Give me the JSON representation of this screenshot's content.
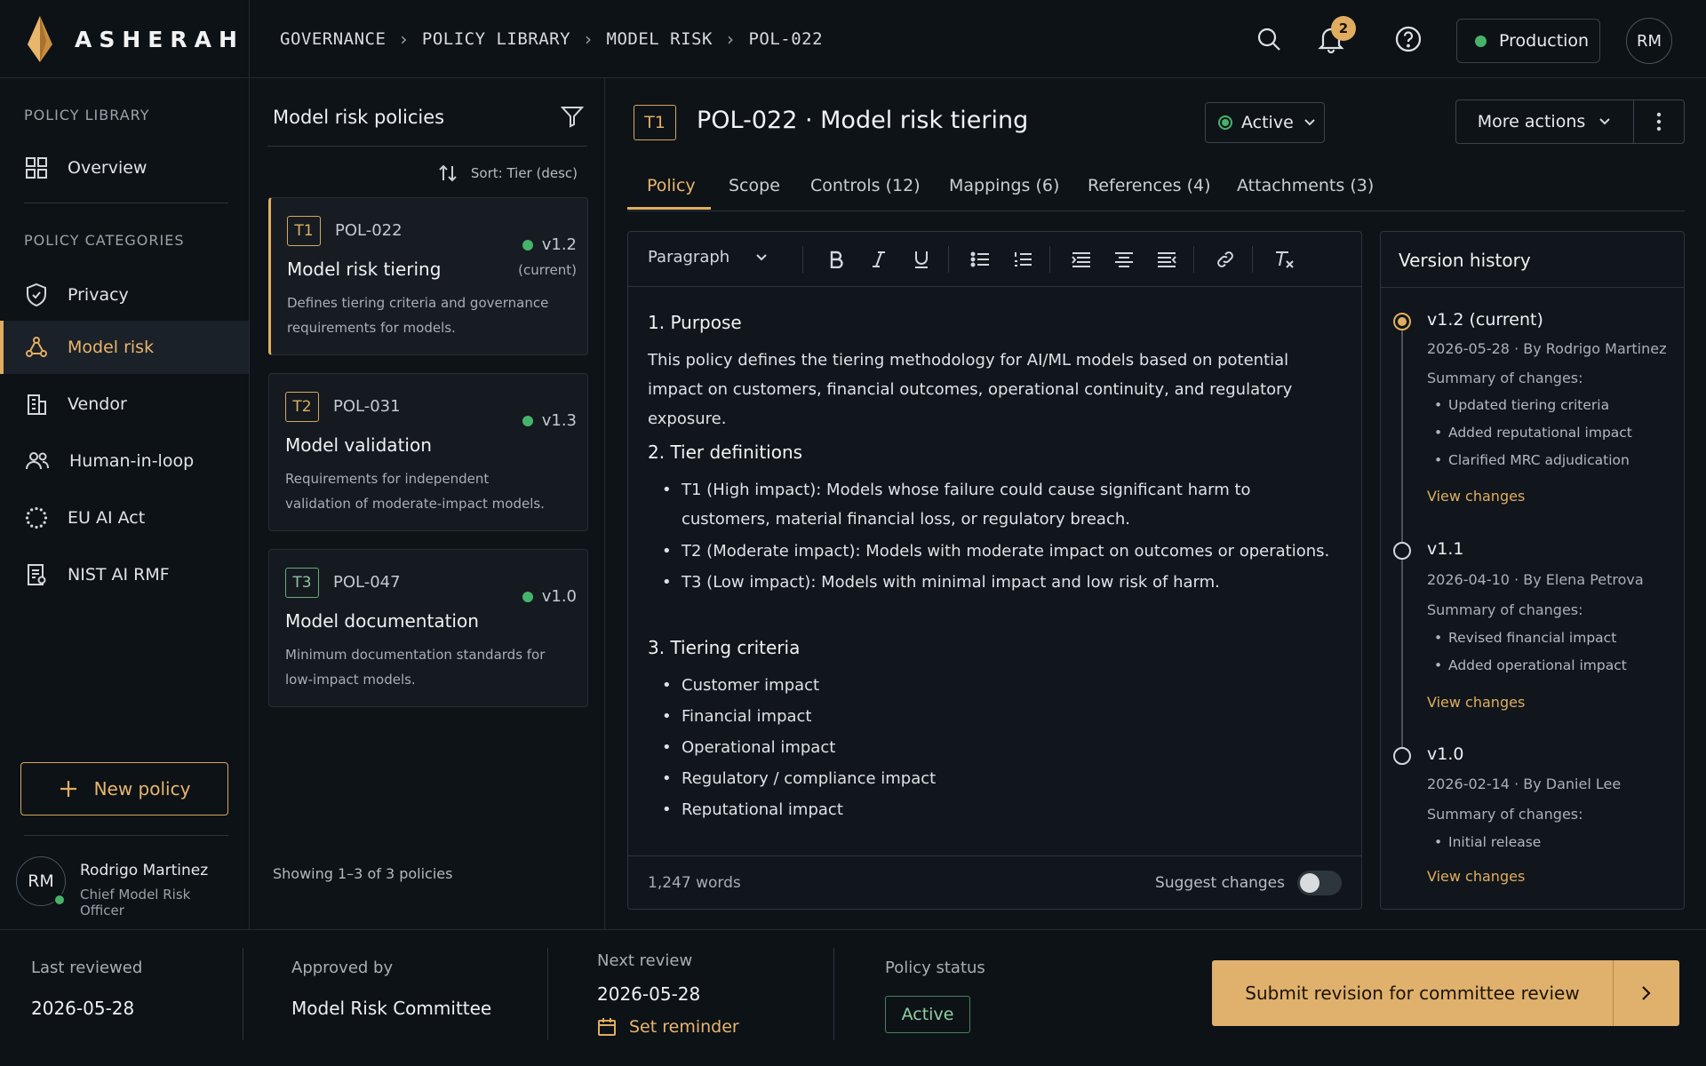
{
  "app": {
    "name": "ASHERAH"
  },
  "breadcrumb": [
    "GOVERNANCE",
    "POLICY LIBRARY",
    "MODEL RISK",
    "POL-022"
  ],
  "topbar": {
    "notifications_count": "2",
    "environment": "Production",
    "user_initials": "RM",
    "icons": [
      "search-icon",
      "bell-icon",
      "help-icon"
    ]
  },
  "sidebar": {
    "library_heading": "POLICY LIBRARY",
    "overview_label": "Overview",
    "categories_heading": "POLICY CATEGORIES",
    "items": [
      {
        "label": "Privacy",
        "icon": "shield-icon",
        "active": false
      },
      {
        "label": "Model risk",
        "icon": "network-icon",
        "active": true
      },
      {
        "label": "Vendor",
        "icon": "building-icon",
        "active": false
      },
      {
        "label": "Human-in-loop",
        "icon": "people-icon",
        "active": false
      },
      {
        "label": "EU AI Act",
        "icon": "stars-circle-icon",
        "active": false
      },
      {
        "label": "NIST AI RMF",
        "icon": "document-icon",
        "active": false
      }
    ],
    "new_policy_label": "New policy",
    "user": {
      "initials": "RM",
      "name": "Rodrigo Martinez",
      "role": "Chief Model Risk Officer"
    }
  },
  "policy_list": {
    "title": "Model risk policies",
    "sort_label": "Sort: Tier (desc)",
    "policies": [
      {
        "tier": "T1",
        "id": "POL-022",
        "version": "v1.2",
        "current_label": "(current)",
        "name": "Model risk tiering",
        "description": "Defines tiering criteria and governance requirements for models."
      },
      {
        "tier": "T2",
        "id": "POL-031",
        "version": "v1.3",
        "current_label": "",
        "name": "Model validation",
        "description": "Requirements for independent validation of moderate-impact models."
      },
      {
        "tier": "T3",
        "id": "POL-047",
        "version": "v1.0",
        "current_label": "",
        "name": "Model documentation",
        "description": "Minimum documentation standards for low-impact models."
      }
    ],
    "footer": "Showing 1–3 of 3 policies"
  },
  "main": {
    "tier": "T1",
    "title": "POL-022 · Model risk tiering",
    "status": "Active",
    "more_actions_label": "More actions",
    "tabs": [
      {
        "label": "Policy",
        "active": true
      },
      {
        "label": "Scope",
        "active": false
      },
      {
        "label": "Controls (12)",
        "active": false
      },
      {
        "label": "Mappings (6)",
        "active": false
      },
      {
        "label": "References (4)",
        "active": false
      },
      {
        "label": "Attachments (3)",
        "active": false
      }
    ]
  },
  "editor": {
    "paragraph_style": "Paragraph",
    "sections": {
      "purpose_heading": "1. Purpose",
      "purpose_text": "This policy defines the tiering methodology for AI/ML models based on potential impact on customers, financial outcomes, operational continuity, and regulatory exposure.",
      "tiers_heading": "2. Tier definitions",
      "tiers": [
        "T1 (High impact): Models whose failure could cause significant harm to customers, material financial loss, or regulatory breach.",
        "T2 (Moderate impact): Models with moderate impact on outcomes or operations.",
        "T3 (Low impact): Models with minimal impact and low risk of harm."
      ],
      "criteria_heading": "3. Tiering criteria",
      "criteria": [
        "Customer impact",
        "Financial impact",
        "Operational impact",
        "Regulatory / compliance impact",
        "Reputational impact"
      ]
    },
    "word_count": "1,247 words",
    "suggest_label": "Suggest changes"
  },
  "version_history": {
    "title": "Version history",
    "summary_label": "Summary of changes:",
    "view_label": "View changes",
    "versions": [
      {
        "version": "v1.2 (current)",
        "date": "2026-05-28",
        "author": "By Rodrigo Martinez",
        "changes": [
          "Updated tiering criteria",
          "Added reputational impact",
          "Clarified MRC adjudication"
        ]
      },
      {
        "version": "v1.1",
        "date": "2026-04-10",
        "author": "By Elena Petrova",
        "changes": [
          "Revised financial impact",
          "Added operational impact"
        ]
      },
      {
        "version": "v1.0",
        "date": "2026-02-14",
        "author": "By Daniel Lee",
        "changes": [
          "Initial release"
        ]
      }
    ]
  },
  "footer": {
    "last_reviewed_label": "Last reviewed",
    "last_reviewed": "2026-05-28",
    "approved_by_label": "Approved by",
    "approved_by": "Model Risk Committee",
    "next_review_label": "Next review",
    "next_review": "2026-05-28",
    "reminder_label": "Set reminder",
    "policy_status_label": "Policy status",
    "policy_status": "Active",
    "submit_label": "Submit revision for committee review"
  },
  "colors": {
    "accent": "#e0ad60",
    "success": "#47b36a",
    "background": "#0e1318"
  }
}
